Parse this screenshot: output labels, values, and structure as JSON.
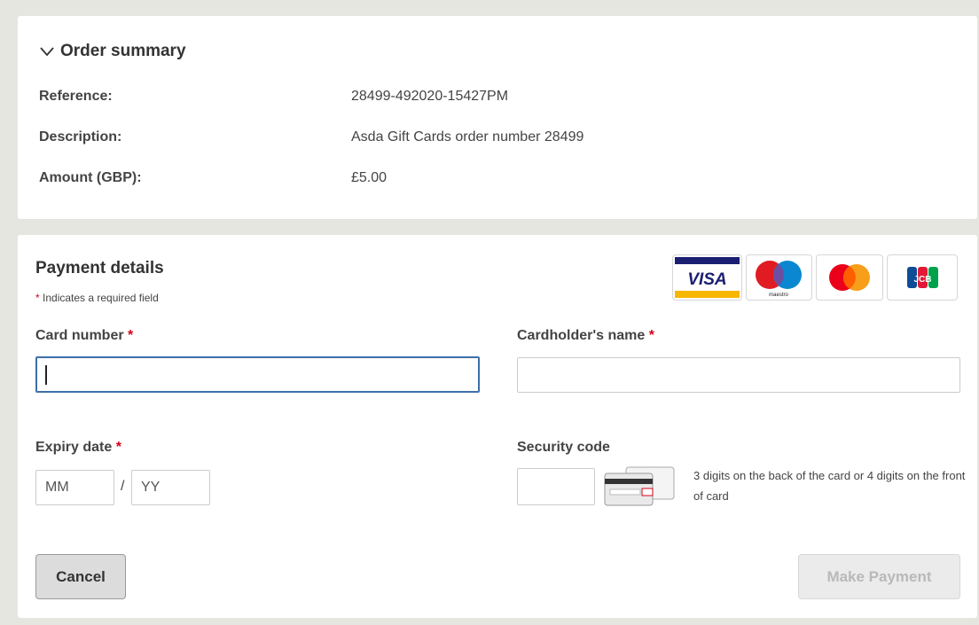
{
  "order_summary": {
    "title": "Order summary",
    "rows": [
      {
        "label": "Reference:",
        "value": "28499-492020-15427PM"
      },
      {
        "label": "Description:",
        "value": "Asda Gift Cards order number 28499"
      },
      {
        "label": "Amount (GBP):",
        "value": "£5.00"
      }
    ]
  },
  "payment": {
    "title": "Payment details",
    "required_star": "*",
    "required_note": "Indicates a required field",
    "card_logos": [
      "visa-logo",
      "maestro-logo",
      "mastercard-logo",
      "jcb-logo"
    ],
    "visa_text": "VISA",
    "maestro_text": "maestro",
    "jcb_text": "JCB",
    "card_number": {
      "label": "Card number",
      "value": ""
    },
    "cardholder_name": {
      "label": "Cardholder's name",
      "value": ""
    },
    "expiry": {
      "label": "Expiry date",
      "month_placeholder": "MM",
      "separator": "/",
      "year_placeholder": "YY"
    },
    "security_code": {
      "label": "Security code",
      "help": "3 digits on the back of the card or 4 digits on the front of card"
    },
    "cancel_label": "Cancel",
    "make_payment_label": "Make Payment"
  },
  "colors": {
    "background": "#e6e6e1",
    "required": "#d0021b",
    "focus_border": "#3d6fa8",
    "disabled_text": "#b9b9b9"
  }
}
